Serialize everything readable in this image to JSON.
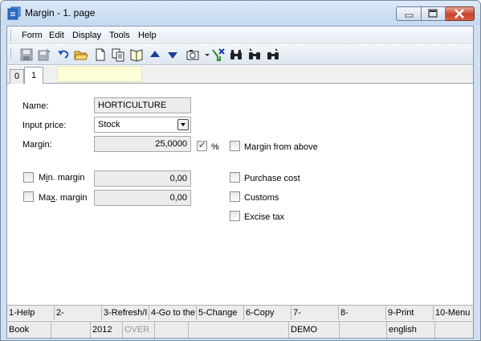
{
  "window": {
    "title": "Margin - 1. page"
  },
  "menu": {
    "items": [
      "Form",
      "Edit",
      "Display",
      "Tools",
      "Help"
    ]
  },
  "toolbar": {
    "icons": [
      "save-icon",
      "save-as-icon",
      "undo-icon",
      "open-folder-icon",
      "new-document-icon",
      "copy-icon",
      "book-icon",
      "arrow-up-icon",
      "arrow-down-icon",
      "camera-icon",
      "filter-icon",
      "binoculars-icon",
      "binoculars-next-icon",
      "binoculars-all-icon"
    ]
  },
  "tabs": {
    "items": [
      "0",
      "1"
    ],
    "active": "1",
    "field_value": ""
  },
  "form": {
    "name_label": "Name:",
    "name_value": "HORTICULTURE",
    "input_price_label": "Input price:",
    "input_price_value": "Stock",
    "margin_label": "Margin:",
    "margin_value": "25,0000",
    "percent_checked": true,
    "percent_label": "%",
    "margin_from_above_label": "Margin from above",
    "margin_from_above_checked": false,
    "min_margin_label_pre": "M",
    "min_margin_label_u": "i",
    "min_margin_label_post": "n. margin",
    "min_margin_value": "0,00",
    "min_margin_checked": false,
    "max_margin_label_pre": "Ma",
    "max_margin_label_u": "x",
    "max_margin_label_post": ". margin",
    "max_margin_value": "0,00",
    "max_margin_checked": false,
    "purchase_cost_label": "Purchase cost",
    "purchase_cost_checked": false,
    "customs_label": "Customs",
    "customs_checked": false,
    "excise_tax_label": "Excise tax",
    "excise_tax_checked": false
  },
  "function_keys": [
    "1-Help",
    "2-",
    "3-Refresh/I",
    "4-Go to the",
    "5-Change",
    "6-Copy",
    "7-",
    "8-",
    "9-Print",
    "10-Menu"
  ],
  "status": {
    "module": "Book",
    "cell2": "",
    "year": "2012",
    "mode": "OVER",
    "cell5": "",
    "cell6": "",
    "database": "DEMO",
    "cell8": "",
    "language": "english",
    "cell10": ""
  },
  "colors": {
    "title_bg": "#cfe0f3",
    "close_button": "#c7442d",
    "tab_field_bg": "#ffffd7"
  }
}
